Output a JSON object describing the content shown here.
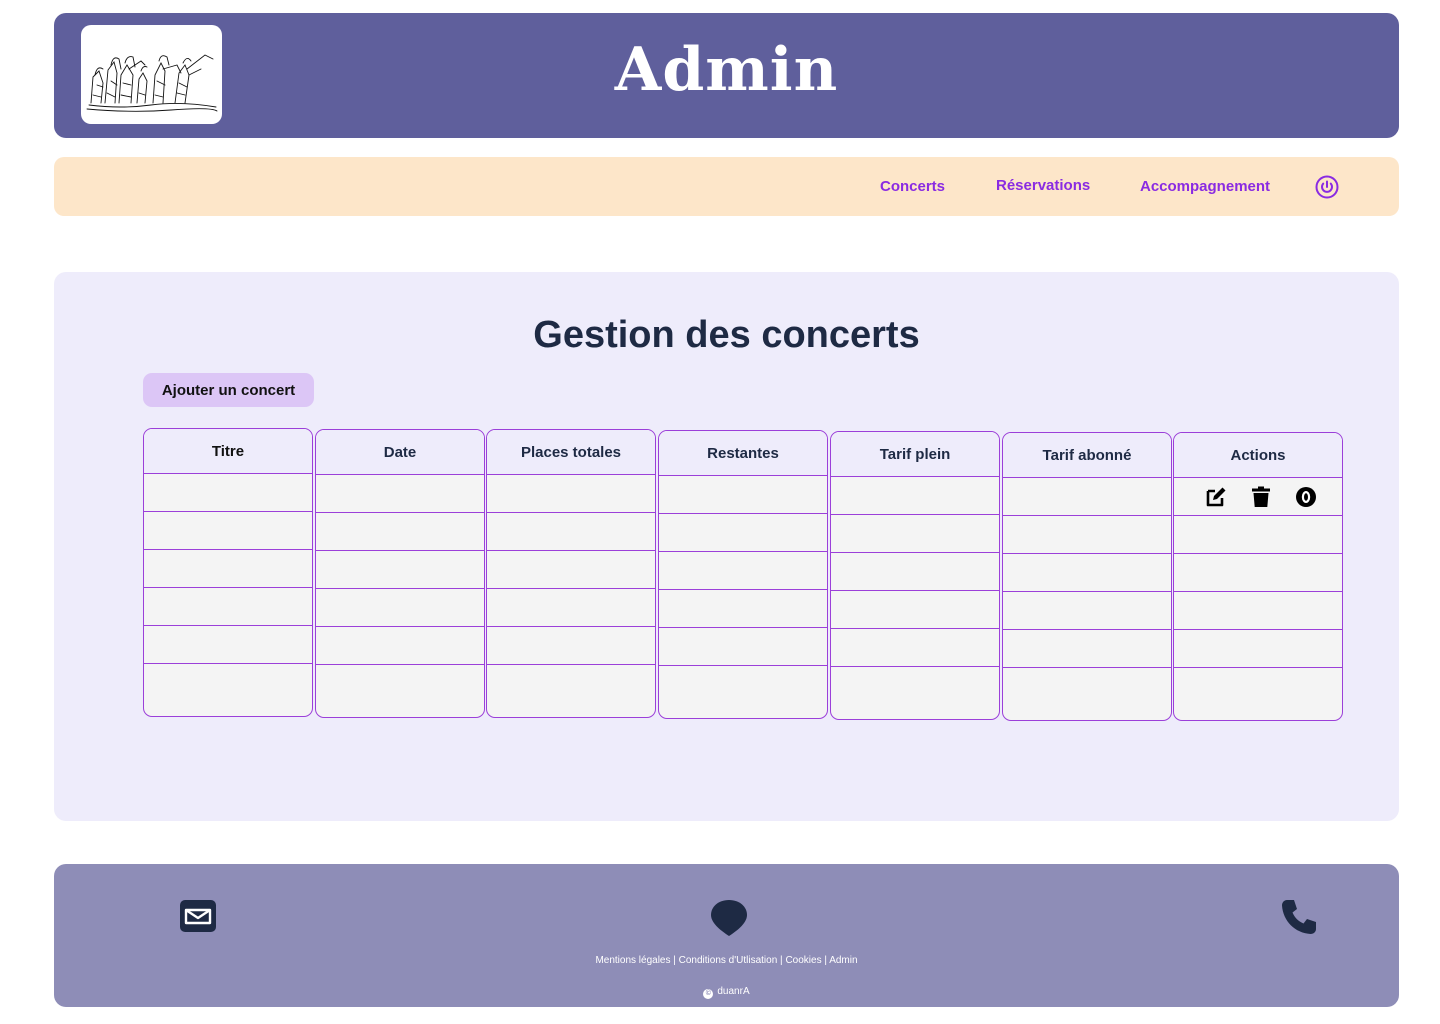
{
  "header": {
    "title": "Admin",
    "logo_icon": "concert-sketch-logo"
  },
  "nav": {
    "items": [
      {
        "label": "Concerts"
      },
      {
        "label": "Réservations"
      },
      {
        "label": "Accompagnement"
      }
    ],
    "logout_icon": "power-icon"
  },
  "main": {
    "title": "Gestion des concerts",
    "add_button": "Ajouter un concert",
    "table": {
      "columns": [
        "Titre",
        "Date",
        "Places totales",
        "Restantes",
        "Tarif plein",
        "Tarif abonné",
        "Actions"
      ],
      "rows": [
        [
          "",
          "",
          "",
          "",
          "",
          "",
          ""
        ],
        [
          "",
          "",
          "",
          "",
          "",
          "",
          ""
        ],
        [
          "",
          "",
          "",
          "",
          "",
          "",
          ""
        ],
        [
          "",
          "",
          "",
          "",
          "",
          "",
          ""
        ],
        [
          "",
          "",
          "",
          "",
          "",
          "",
          ""
        ],
        [
          "",
          "",
          "",
          "",
          "",
          "",
          ""
        ]
      ],
      "row_actions": [
        "edit-icon",
        "trash-icon",
        "eye-off-icon"
      ]
    }
  },
  "footer": {
    "icons": [
      "mail-icon",
      "location-pin-icon",
      "phone-icon"
    ],
    "links": [
      "Mentions légales",
      "Conditions d'Utlisation",
      "Cookies",
      "Admin"
    ],
    "separator": " | ",
    "copyright_text": "duanrA"
  },
  "colors": {
    "header_bg": "#5f5f9c",
    "nav_bg": "#fde6c9",
    "nav_link": "#8a2be2",
    "panel_bg": "#eeecfb",
    "table_border": "#9b3fd9",
    "add_button_bg": "#dcc6f6",
    "footer_bg": "#8e8db7",
    "title_text": "#1e2a44"
  }
}
